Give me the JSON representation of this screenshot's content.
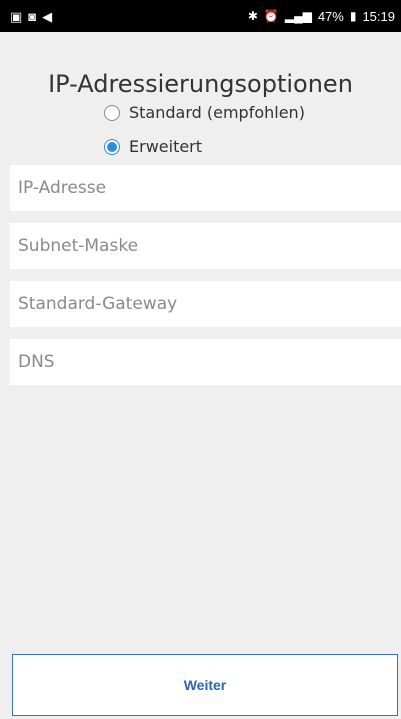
{
  "status_bar": {
    "left_icons": [
      "image-icon",
      "headset-icon",
      "send-icon"
    ],
    "right_icons": [
      "bluetooth-icon",
      "alarm-icon",
      "signal-icon"
    ],
    "battery": "47%",
    "time": "15:19"
  },
  "title": "IP-Adressierungsoptionen",
  "radio_options": [
    {
      "label": "Standard (empfohlen)",
      "selected": false
    },
    {
      "label": "Erweitert",
      "selected": true
    }
  ],
  "fields": [
    {
      "placeholder": "IP-Adresse"
    },
    {
      "placeholder": "Subnet-Maske"
    },
    {
      "placeholder": "Standard-Gateway"
    },
    {
      "placeholder": "DNS"
    }
  ],
  "next_button": {
    "label": "Weiter"
  },
  "colors": {
    "accent": "#2a8ed8",
    "button_text": "#2d64b4",
    "background": "#efefef"
  }
}
